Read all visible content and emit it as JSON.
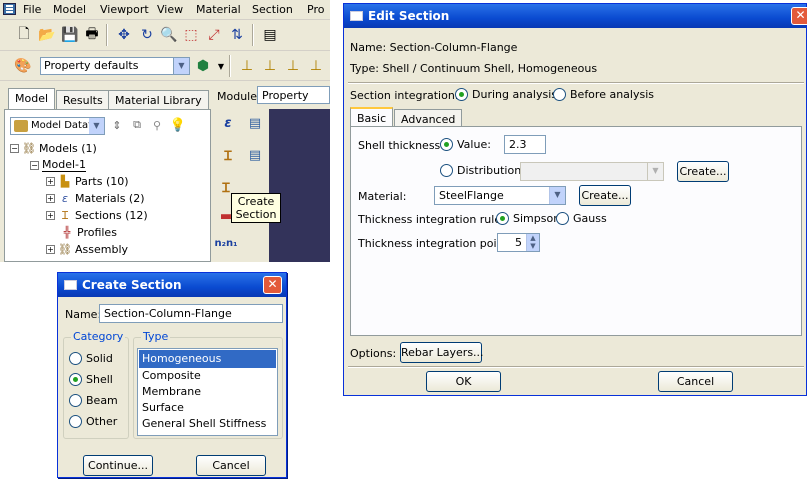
{
  "app": {
    "menu": [
      "File",
      "Model",
      "Viewport",
      "View",
      "Material",
      "Section",
      "Pro"
    ],
    "property_defaults": "Property defaults",
    "tabs": [
      "Model",
      "Results",
      "Material Library"
    ],
    "model_db": "Model Datat",
    "module_label": "Module:",
    "module_value": "Property",
    "tooltip_line1": "Create",
    "tooltip_line2": "Section",
    "tree": [
      {
        "label": "Models (1)"
      },
      {
        "label": "Model-1"
      },
      {
        "label": "Parts (10)"
      },
      {
        "label": "Materials (2)"
      },
      {
        "label": "Sections (12)"
      },
      {
        "label": "Profiles"
      },
      {
        "label": "Assembly"
      }
    ]
  },
  "create_section": {
    "title": "Create Section",
    "name_label": "Name:",
    "name_value": "Section-Column-Flange",
    "category_title": "Category",
    "type_title": "Type",
    "categories": [
      "Solid",
      "Shell",
      "Beam",
      "Other"
    ],
    "selected_category": "Shell",
    "types": [
      "Homogeneous",
      "Composite",
      "Membrane",
      "Surface",
      "General Shell Stiffness"
    ],
    "selected_type": "Homogeneous",
    "continue_label": "Continue...",
    "cancel_label": "Cancel"
  },
  "edit_section": {
    "title": "Edit Section",
    "name_line": "Name:  Section-Column-Flange",
    "type_line": "Type:   Shell / Continuum Shell, Homogeneous",
    "integration_label": "Section integration:",
    "integration_options": [
      "During analysis",
      "Before analysis"
    ],
    "tabs": [
      "Basic",
      "Advanced"
    ],
    "shell_thickness_label": "Shell thickness:",
    "value_label": "Value:",
    "value": "2.3",
    "distribution_label": "Distribution:",
    "create_label": "Create...",
    "material_label": "Material:",
    "material_value": "SteelFlange",
    "thickness_rule_label": "Thickness integration rule:",
    "rule_options": [
      "Simpson",
      "Gauss"
    ],
    "points_label": "Thickness integration points:",
    "points_value": "5",
    "options_label": "Options:",
    "rebar_label": "Rebar Layers...",
    "ok_label": "OK",
    "cancel_label": "Cancel"
  }
}
